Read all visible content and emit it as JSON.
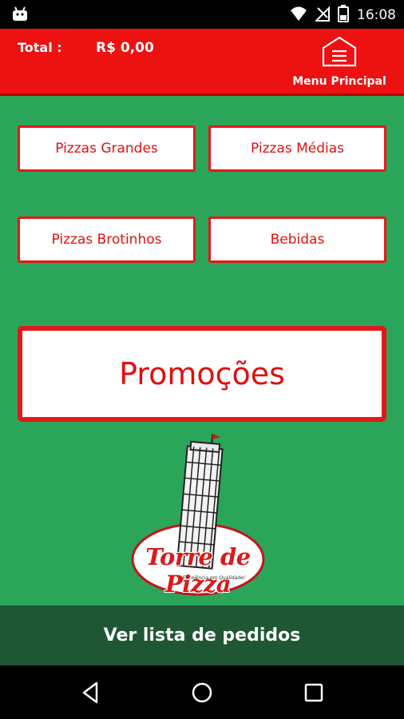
{
  "status": {
    "time": "16:08",
    "icons": [
      "android-icon",
      "wifi-icon",
      "no-signal-icon",
      "battery-icon"
    ]
  },
  "header": {
    "total_label": "Total :",
    "total_value": "R$ 0,00",
    "menu_label": "Menu Principal",
    "menu_icon": "home-menu-icon"
  },
  "categories": [
    {
      "label": "Pizzas Grandes"
    },
    {
      "label": "Pizzas Médias"
    },
    {
      "label": "Pizzas Brotinhos"
    },
    {
      "label": "Bebidas"
    }
  ],
  "promo": {
    "label": "Promoções"
  },
  "logo": {
    "name": "Torre de Pizza",
    "tagline": "Excelência em Qualidade!"
  },
  "bottom": {
    "label": "Ver lista de pedidos"
  },
  "navbar": {
    "icons": [
      "back-icon",
      "home-icon",
      "recents-icon"
    ]
  },
  "colors": {
    "background": "#2aa55a",
    "header": "#ee1111",
    "button_border": "#e3181a",
    "bottom_bar": "#1f5634"
  }
}
